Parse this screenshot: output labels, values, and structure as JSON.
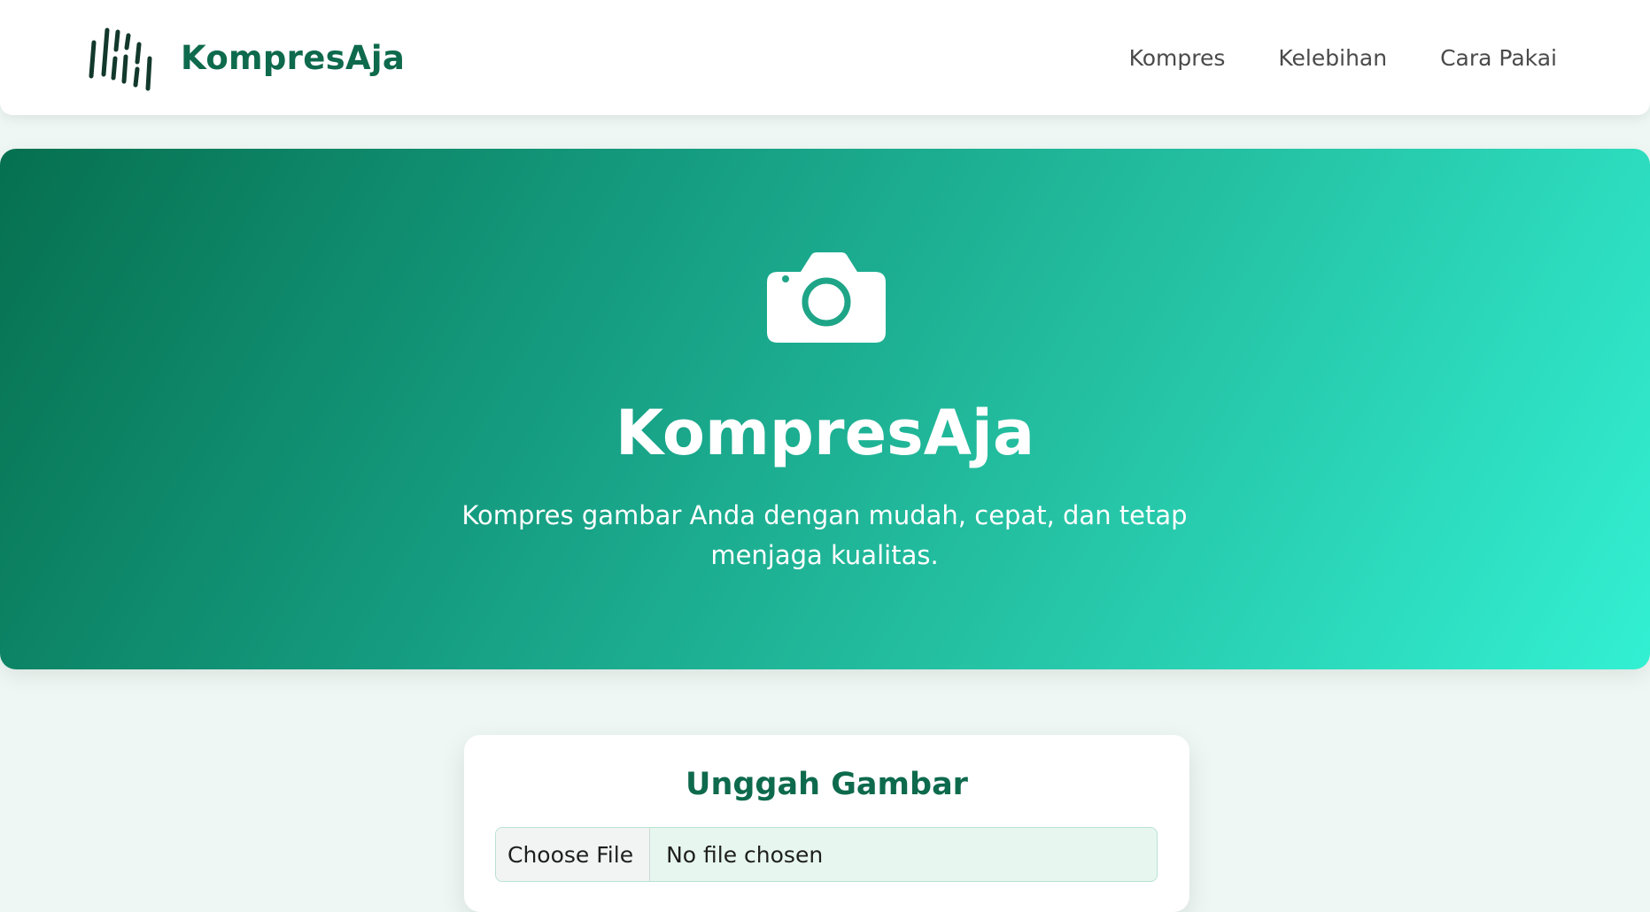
{
  "app": {
    "name": "KompresAja",
    "brand_color": "#0e6a4c"
  },
  "navbar": {
    "logo_icon": "barcode-lines-icon",
    "links": [
      {
        "label": "Kompres"
      },
      {
        "label": "Kelebihan"
      },
      {
        "label": "Cara Pakai"
      }
    ]
  },
  "hero": {
    "icon": "camera-icon",
    "title": "KompresAja",
    "subtitle": "Kompres gambar Anda dengan mudah, cepat, dan tetap menjaga kualitas.",
    "gradient_start": "#06704f",
    "gradient_end": "#33f0d3"
  },
  "upload": {
    "title": "Unggah Gambar",
    "choose_button": "Choose File",
    "file_status": "No file chosen"
  }
}
